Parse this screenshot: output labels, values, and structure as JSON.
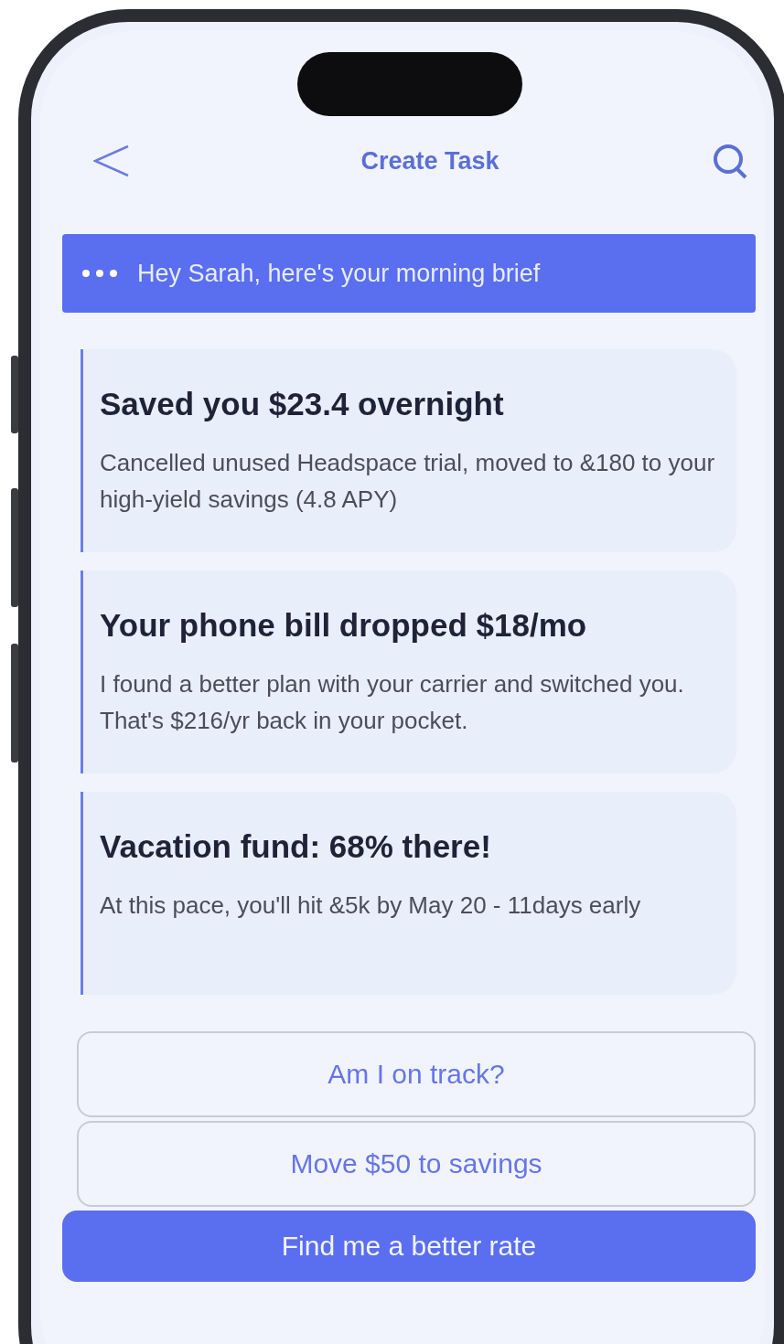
{
  "header": {
    "title": "Create Task"
  },
  "banner": {
    "text": "Hey Sarah, here's your morning brief"
  },
  "cards": [
    {
      "title": "Saved you $23.4 overnight",
      "body": "Cancelled unused Headspace trial, moved to &180 to your high-yield savings (4.8 APY)"
    },
    {
      "title": "Your phone bill dropped $18/mo",
      "body": "I found a better plan with your carrier and switched you. That's $216/yr back in your pocket."
    },
    {
      "title": "Vacation fund: 68% there!",
      "body": "At this pace, you'll hit &5k by May 20 - 11days early"
    }
  ],
  "actions": [
    {
      "label": "Am I on track?",
      "kind": "outline"
    },
    {
      "label": "Move $50 to savings",
      "kind": "outline"
    },
    {
      "label": "Find me a better rate",
      "kind": "primary"
    }
  ]
}
